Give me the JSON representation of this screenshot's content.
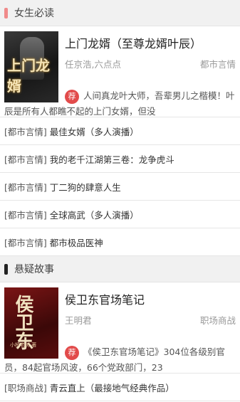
{
  "sections": [
    {
      "title": "女生必读",
      "bar_color": "#f08a8a",
      "featured": {
        "title": "上门龙婿（至尊龙婿叶辰）",
        "author": "任京浩,六点点",
        "category": "都市言情",
        "rec_badge": "荐",
        "description": "人间真龙叶大师，吾辈男儿之楷模！叶辰是所有人都瞧不起的上门女婿，但没",
        "cover_text": "上门龙婿"
      },
      "list": [
        {
          "category": "[都市言情]",
          "title": "最佳女婿（多人演播）"
        },
        {
          "category": "[都市言情]",
          "title": "我的老千江湖第三卷：龙争虎斗"
        },
        {
          "category": "[都市言情]",
          "title": "丁二狗的肆意人生"
        },
        {
          "category": "[都市言情]",
          "title": "全球高武（多人演播）"
        },
        {
          "category": "[都市言情]",
          "title": "都市极品医神"
        }
      ]
    },
    {
      "title": "悬疑故事",
      "bar_color": "#222222",
      "featured": {
        "title": "侯卫东官场笔记",
        "author": "王明君",
        "category": "职场商战",
        "rec_badge": "荐",
        "description": "《侯卫东官场笔记》304位各级别官员，84起官场风波，66个党政部门，23",
        "cover_text": "侯卫东",
        "cover_author": "小桥老树 著"
      },
      "list": [
        {
          "category": "[职场商战]",
          "title": "青云直上（最接地气经典作品）"
        }
      ]
    }
  ]
}
